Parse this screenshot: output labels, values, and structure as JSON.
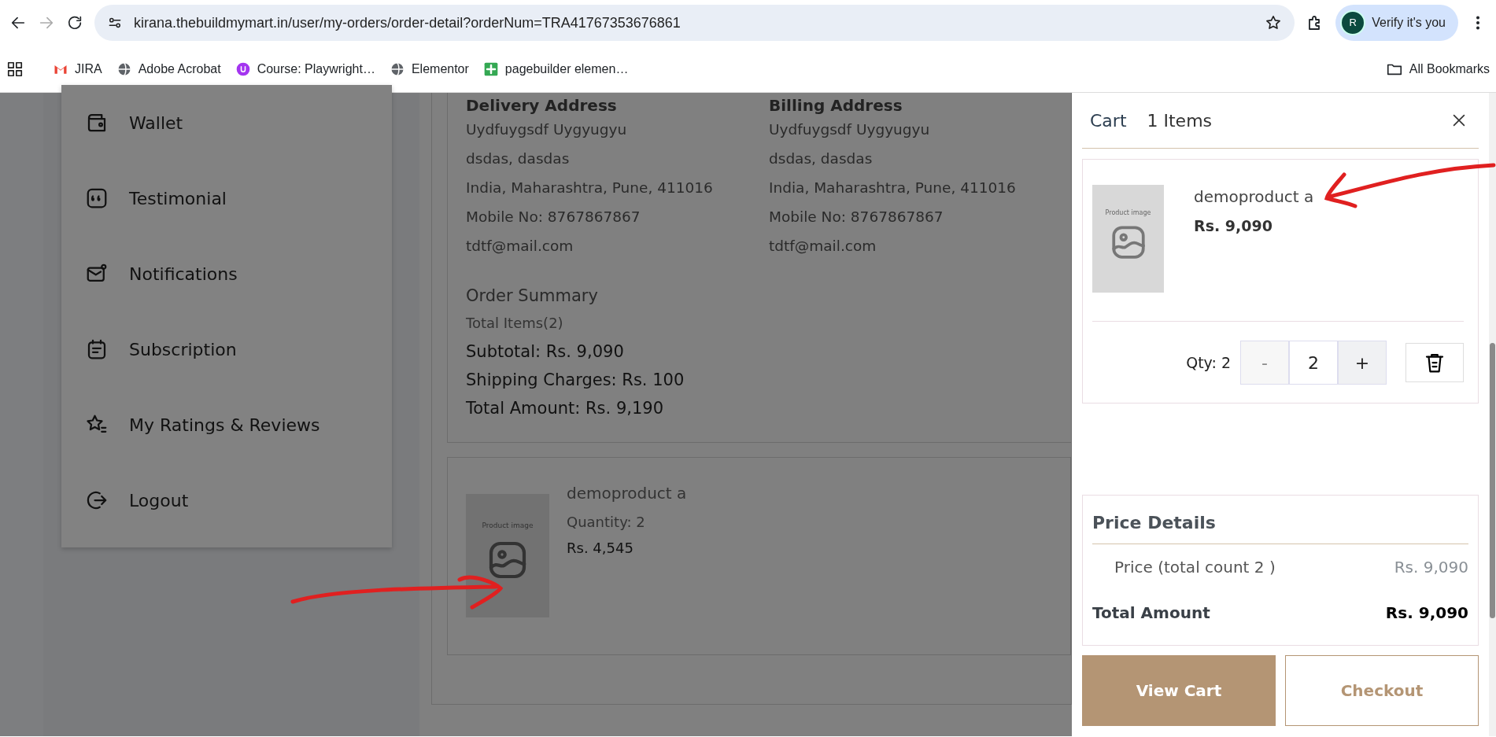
{
  "browser": {
    "url": "kirana.thebuildmymart.in/user/my-orders/order-detail?orderNum=TRA41767353676861",
    "avatar_letter": "R",
    "profile_label": "Verify it's you",
    "bookmarks": [
      {
        "label": "JIRA"
      },
      {
        "label": "Adobe Acrobat"
      },
      {
        "label": "Course: Playwright…"
      },
      {
        "label": "Elementor"
      },
      {
        "label": "pagebuilder elemen…"
      }
    ],
    "all_bookmarks": "All Bookmarks"
  },
  "sidebar": {
    "items": [
      {
        "label": "Wallet"
      },
      {
        "label": "Testimonial"
      },
      {
        "label": "Notifications"
      },
      {
        "label": "Subscription"
      },
      {
        "label": "My Ratings & Reviews"
      },
      {
        "label": "Logout"
      }
    ]
  },
  "order": {
    "addresses": [
      {
        "heading": "Delivery Address",
        "lines": [
          "Uydfuygsdf Uygyugyu",
          "dsdas, dasdas",
          "India, Maharashtra, Pune, 411016",
          "Mobile No: 8767867867",
          "tdtf@mail.com"
        ]
      },
      {
        "heading": "Billing Address",
        "lines": [
          "Uydfuygsdf Uygyugyu",
          "dsdas, dasdas",
          "India, Maharashtra, Pune, 411016",
          "Mobile No: 8767867867",
          "tdtf@mail.com"
        ]
      }
    ],
    "summary": {
      "heading": "Order Summary",
      "total_items": "Total Items(2)",
      "lines": [
        "Subtotal: Rs. 9,090",
        "Shipping Charges: Rs. 100",
        "Total Amount: Rs. 9,190"
      ]
    },
    "products": [
      {
        "image_label": "Product image",
        "name": "demoproduct a",
        "quantity": "Quantity: 2",
        "price": "Rs. 4,545"
      }
    ]
  },
  "cart": {
    "title": "Cart",
    "count": "1 Items",
    "items": [
      {
        "image_label": "Product image",
        "name": "demoproduct a",
        "price": "Rs. 9,090",
        "qty_label": "Qty: 2",
        "minus": "-",
        "quantity": "2",
        "plus": "+"
      }
    ],
    "price_details": {
      "heading": "Price Details",
      "rows": [
        {
          "kind": "price",
          "label": "Price (total count 2 )",
          "value": "Rs. 9,090"
        },
        {
          "kind": "total",
          "label": "Total Amount",
          "value": "Rs. 9,090"
        }
      ]
    },
    "buttons": [
      {
        "kind": "primary",
        "label": "View Cart"
      },
      {
        "kind": "outline",
        "label": "Checkout"
      }
    ]
  }
}
